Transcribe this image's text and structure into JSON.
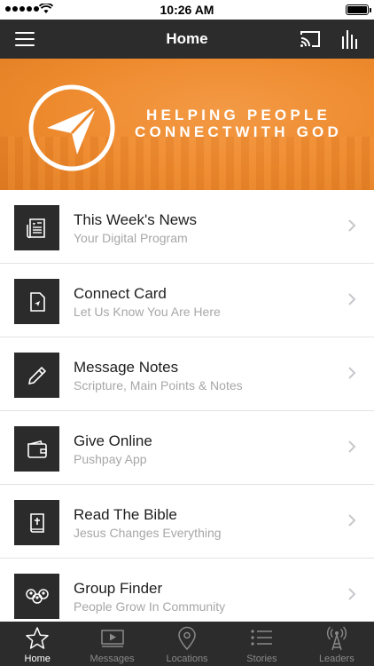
{
  "status_bar": {
    "time": "10:26 AM"
  },
  "nav": {
    "title": "Home"
  },
  "banner": {
    "tagline_line1": "HELPING PEOPLE",
    "tagline_line2": "CONNECTWITH GOD",
    "accent": "#ee8a2e"
  },
  "items": [
    {
      "title": "This Week's News",
      "subtitle": "Your Digital Program",
      "icon": "newspaper-icon"
    },
    {
      "title": "Connect Card",
      "subtitle": "Let Us Know You Are Here",
      "icon": "card-arrow-icon"
    },
    {
      "title": "Message Notes",
      "subtitle": "Scripture, Main Points & Notes",
      "icon": "pencil-icon"
    },
    {
      "title": "Give Online",
      "subtitle": "Pushpay App",
      "icon": "wallet-icon"
    },
    {
      "title": "Read The Bible",
      "subtitle": "Jesus Changes Everything",
      "icon": "bible-icon"
    },
    {
      "title": "Group Finder",
      "subtitle": "People Grow In Community",
      "icon": "people-group-icon"
    }
  ],
  "tabs": [
    {
      "label": "Home",
      "icon": "star-icon",
      "active": true
    },
    {
      "label": "Messages",
      "icon": "video-icon",
      "active": false
    },
    {
      "label": "Locations",
      "icon": "location-pin-icon",
      "active": false
    },
    {
      "label": "Stories",
      "icon": "list-icon",
      "active": false
    },
    {
      "label": "Leaders",
      "icon": "broadcast-tower-icon",
      "active": false
    }
  ],
  "colors": {
    "nav_bg": "#2c2c2c",
    "banner_orange": "#ee8a2e",
    "subtitle_gray": "#a7a7a7"
  }
}
